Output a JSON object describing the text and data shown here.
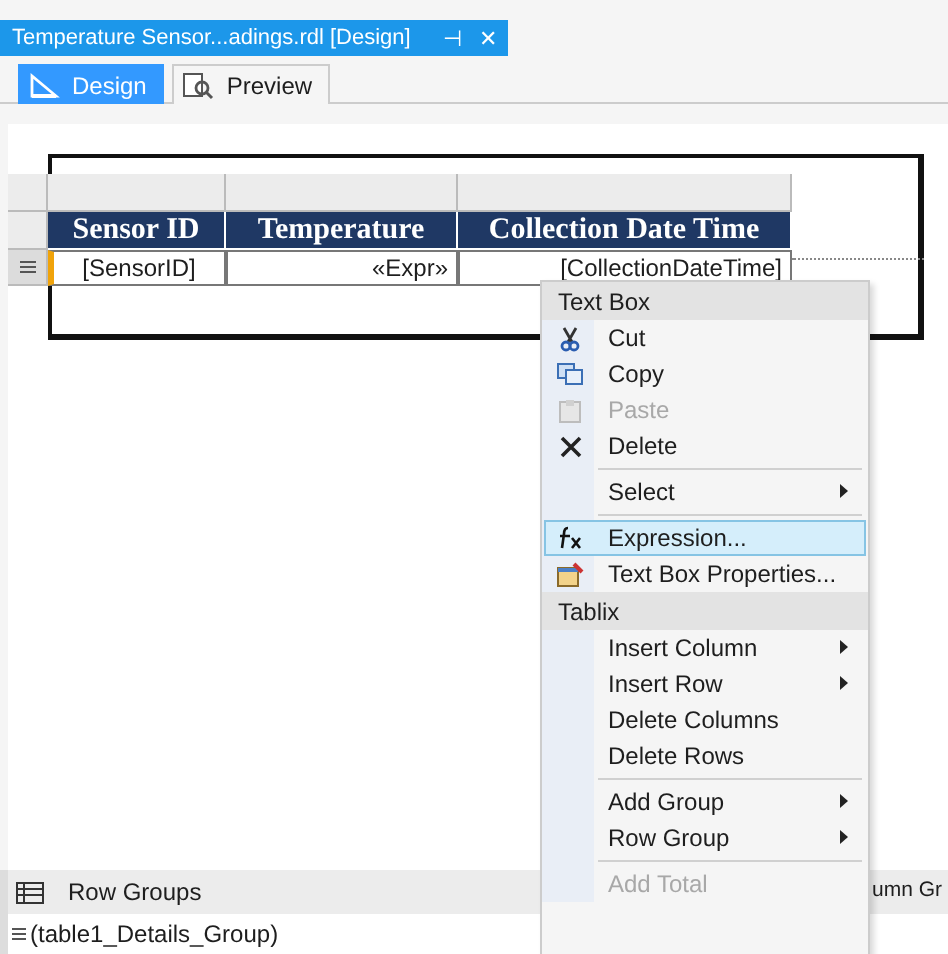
{
  "document_tab": {
    "title": "Temperature Sensor...adings.rdl [Design]",
    "pin": "⊣",
    "close": "✕"
  },
  "view_tabs": [
    {
      "label": "Design",
      "selected": true
    },
    {
      "label": "Preview",
      "selected": false
    }
  ],
  "table": {
    "columns": [
      "Sensor ID",
      "Temperature",
      "Collection Date Time"
    ],
    "row": [
      "[SensorID]",
      "«Expr»",
      "[CollectionDateTime]"
    ],
    "row_selected": true
  },
  "context_menu": {
    "items": [
      {
        "kind": "header",
        "label": "Text Box"
      },
      {
        "kind": "item",
        "label": "Cut",
        "disabled": false,
        "submenu": false,
        "highlighted": false
      },
      {
        "kind": "item",
        "label": "Copy",
        "disabled": false,
        "submenu": false,
        "highlighted": false
      },
      {
        "kind": "item",
        "label": "Paste",
        "disabled": true,
        "submenu": false,
        "highlighted": false
      },
      {
        "kind": "item",
        "label": "Delete",
        "disabled": false,
        "submenu": false,
        "highlighted": false
      },
      {
        "kind": "separator"
      },
      {
        "kind": "item",
        "label": "Select",
        "disabled": false,
        "submenu": true,
        "highlighted": false
      },
      {
        "kind": "separator"
      },
      {
        "kind": "item",
        "label": "Expression...",
        "disabled": false,
        "submenu": false,
        "highlighted": true
      },
      {
        "kind": "item",
        "label": "Text Box Properties...",
        "disabled": false,
        "submenu": false,
        "highlighted": false
      },
      {
        "kind": "header",
        "label": "Tablix"
      },
      {
        "kind": "item",
        "label": "Insert Column",
        "disabled": false,
        "submenu": true,
        "highlighted": false
      },
      {
        "kind": "item",
        "label": "Insert Row",
        "disabled": false,
        "submenu": true,
        "highlighted": false
      },
      {
        "kind": "item",
        "label": "Delete Columns",
        "disabled": false,
        "submenu": false,
        "highlighted": false
      },
      {
        "kind": "item",
        "label": "Delete Rows",
        "disabled": false,
        "submenu": false,
        "highlighted": false
      },
      {
        "kind": "separator"
      },
      {
        "kind": "item",
        "label": "Add Group",
        "disabled": false,
        "submenu": true,
        "highlighted": false
      },
      {
        "kind": "item",
        "label": "Row Group",
        "disabled": false,
        "submenu": true,
        "highlighted": false
      },
      {
        "kind": "separator"
      },
      {
        "kind": "item",
        "label": "Add Total",
        "disabled": true,
        "submenu": false,
        "highlighted": false
      }
    ]
  },
  "groups_panel": {
    "row_groups_title": "Row Groups",
    "column_groups_title": "umn Gr",
    "groups": [
      "(table1_Details_Group)"
    ]
  }
}
